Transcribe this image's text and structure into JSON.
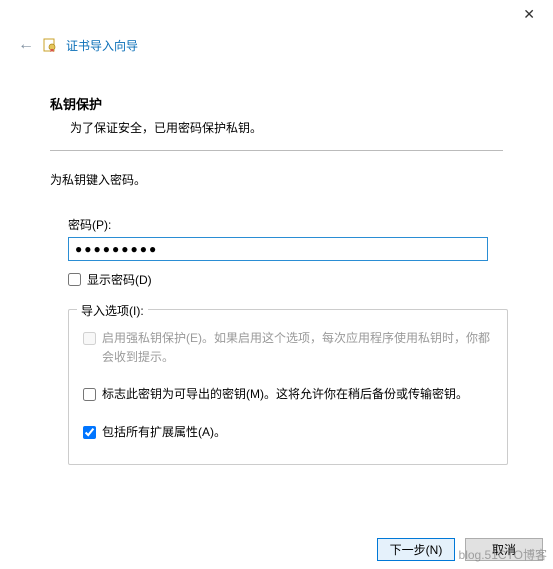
{
  "window": {
    "close_glyph": "✕"
  },
  "header": {
    "back_glyph": "←",
    "title": "证书导入向导"
  },
  "section": {
    "heading": "私钥保护",
    "desc": "为了保证安全，已用密码保护私钥。"
  },
  "instruction": "为私钥键入密码。",
  "password": {
    "label": "密码(P):",
    "value": "●●●●●●●●●",
    "show_label": "显示密码(D)",
    "show_checked": false
  },
  "import_options": {
    "title": "导入选项(I):",
    "opts": [
      {
        "label": "启用强私钥保护(E)。如果启用这个选项，每次应用程序使用私钥时，你都会收到提示。",
        "checked": false,
        "disabled": true
      },
      {
        "label": "标志此密钥为可导出的密钥(M)。这将允许你在稍后备份或传输密钥。",
        "checked": false,
        "disabled": false
      },
      {
        "label": "包括所有扩展属性(A)。",
        "checked": true,
        "disabled": false
      }
    ]
  },
  "footer": {
    "next": "下一步(N)",
    "cancel": "取消"
  },
  "watermark": "blog.51CTO博客"
}
